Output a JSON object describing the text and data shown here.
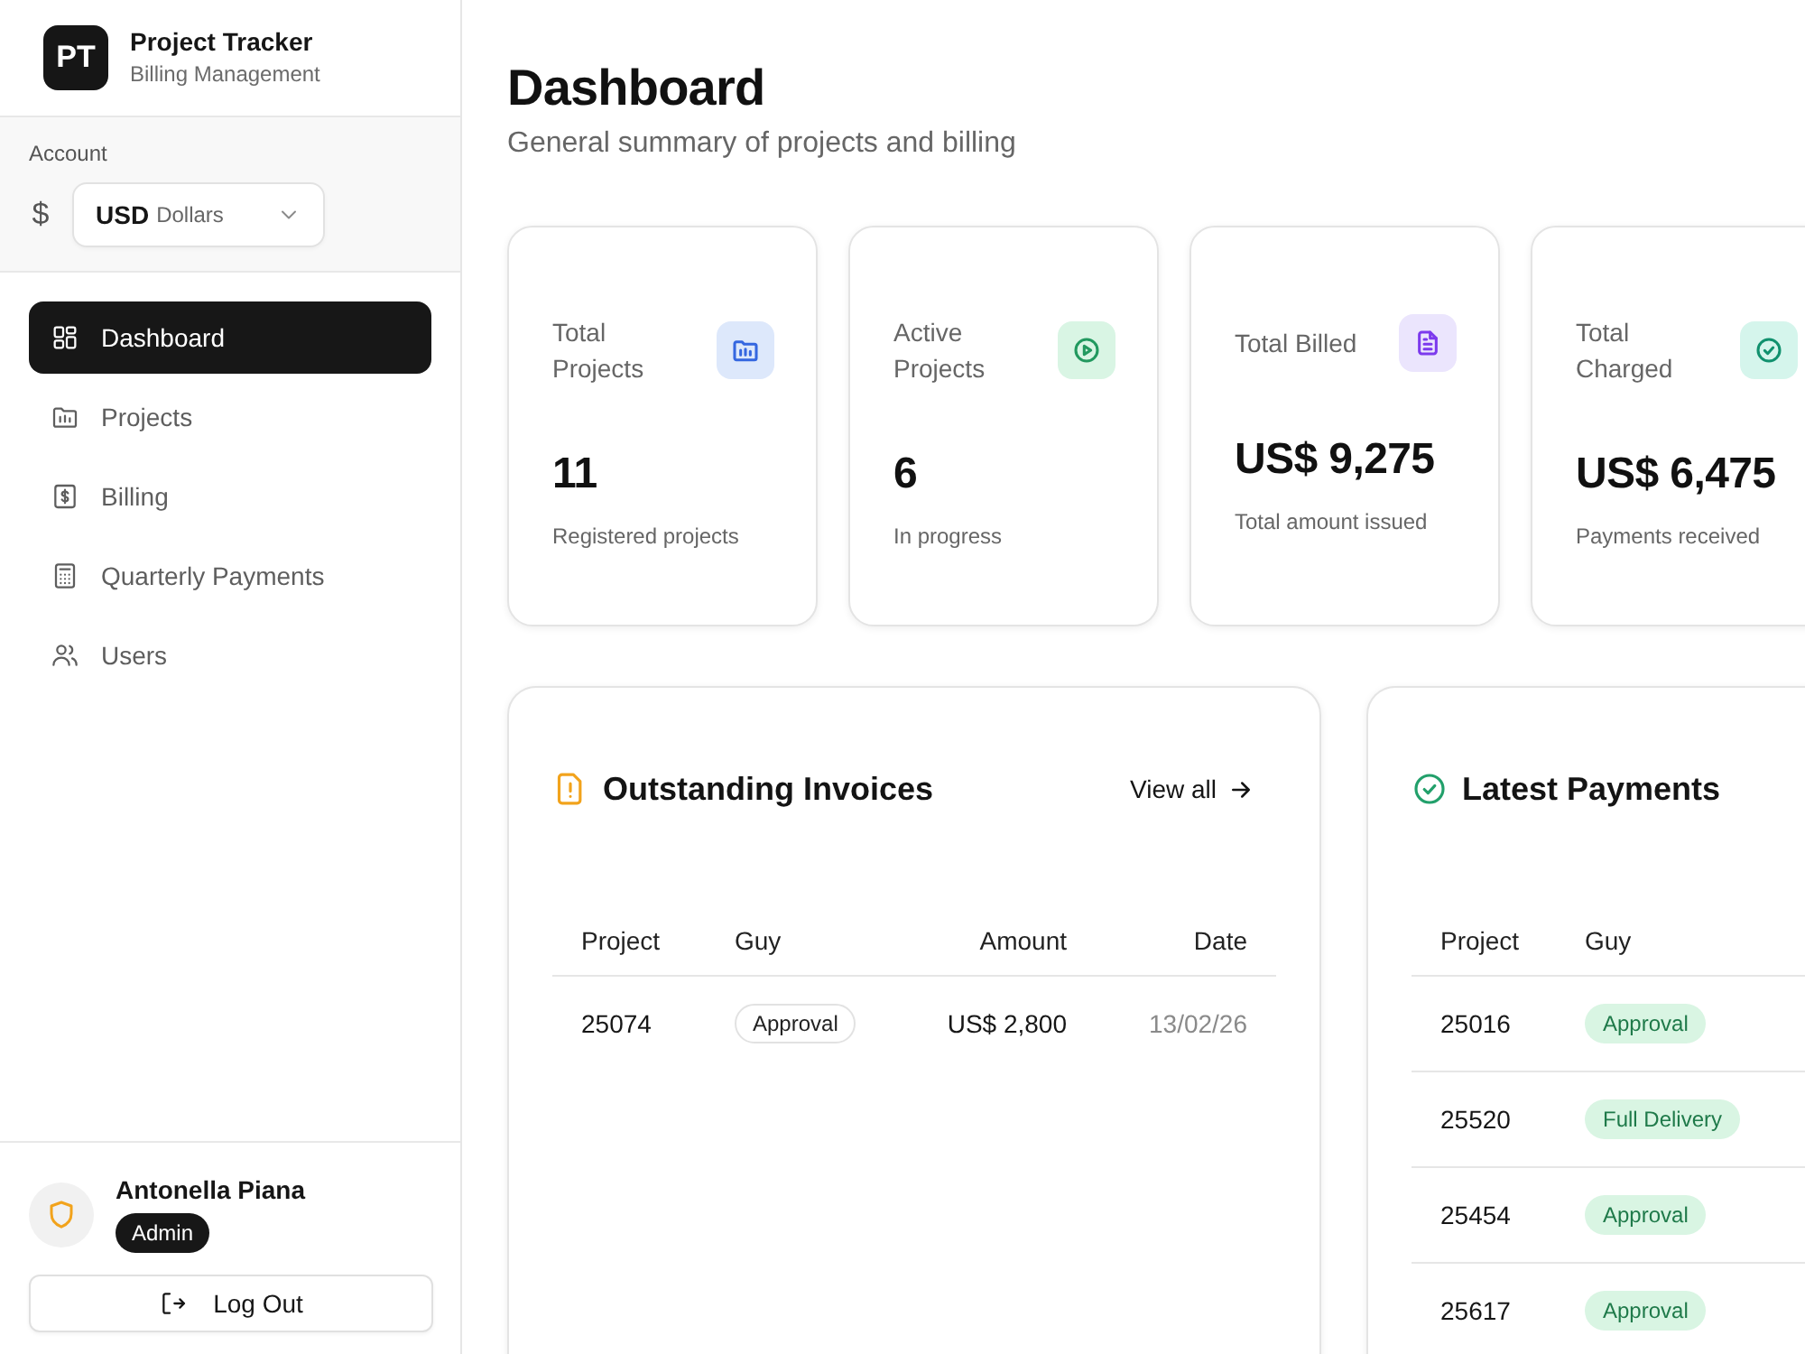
{
  "sidebar": {
    "brand": {
      "logo": "PT",
      "title": "Project Tracker",
      "subtitle": "Billing Management"
    },
    "account": {
      "label": "Account",
      "currency_symbol": "$",
      "currency_code": "USD",
      "currency_name": "Dollars"
    },
    "nav": [
      {
        "label": "Dashboard",
        "selected": true
      },
      {
        "label": "Projects",
        "selected": false
      },
      {
        "label": "Billing",
        "selected": false
      },
      {
        "label": "Quarterly Payments",
        "selected": false
      },
      {
        "label": "Users",
        "selected": false
      }
    ],
    "user": {
      "name": "Antonella Piana",
      "role": "Admin"
    },
    "logout": "Log Out"
  },
  "header": {
    "title": "Dashboard",
    "subtitle": "General summary of projects and billing"
  },
  "stats": [
    {
      "label": "Total Projects",
      "value": "11",
      "note": "Registered projects"
    },
    {
      "label": "Active Projects",
      "value": "6",
      "note": "In progress"
    },
    {
      "label": "Total Billed",
      "value": "US$ 9,275",
      "note": "Total amount issued"
    },
    {
      "label": "Total Charged",
      "value": "US$ 6,475",
      "note": "Payments received"
    }
  ],
  "panels": [
    {
      "title": "Outstanding Invoices",
      "link": "View all",
      "columns": [
        {
          "label": "Project",
          "kind": "text"
        },
        {
          "label": "Guy",
          "kind": "badge"
        },
        {
          "label": "Amount",
          "kind": "amount"
        },
        {
          "label": "Date",
          "kind": "date"
        }
      ],
      "rows": [
        [
          "25074",
          "Approval",
          "US$ 2,800",
          "13/02/26"
        ]
      ]
    },
    {
      "title": "Latest Payments",
      "columns": [
        {
          "label": "Project",
          "kind": "text"
        },
        {
          "label": "Guy",
          "kind": "badge"
        }
      ],
      "rows": [
        [
          "25016",
          "Approval"
        ],
        [
          "25520",
          "Full Delivery"
        ],
        [
          "25454",
          "Approval"
        ],
        [
          "25617",
          "Approval"
        ]
      ]
    }
  ]
}
